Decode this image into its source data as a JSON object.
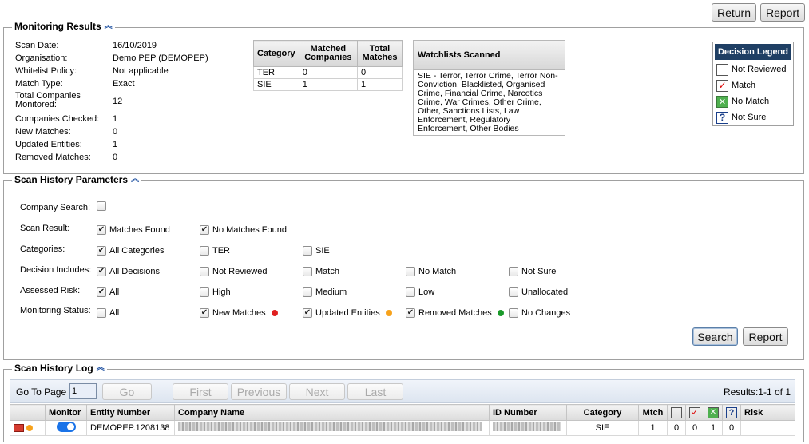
{
  "top_buttons": {
    "return_label": "Return",
    "report_label": "Report"
  },
  "monitoring": {
    "title": "Monitoring Results",
    "fields": [
      {
        "label": "Scan Date:",
        "value": "16/10/2019"
      },
      {
        "label": "Organisation:",
        "value": "Demo PEP (DEMOPEP)"
      },
      {
        "label": "Whitelist Policy:",
        "value": "Not applicable"
      },
      {
        "label": "Match Type:",
        "value": "Exact"
      },
      {
        "label": "Total Companies Monitored:",
        "value": "12"
      },
      {
        "label": "Companies Checked:",
        "value": "1"
      },
      {
        "label": "New Matches:",
        "value": "0"
      },
      {
        "label": "Updated Entities:",
        "value": "1"
      },
      {
        "label": "Removed Matches:",
        "value": "0"
      }
    ],
    "category_table": {
      "headers": [
        "Category",
        "Matched Companies",
        "Total Matches"
      ],
      "rows": [
        [
          "TER",
          "0",
          "0"
        ],
        [
          "SIE",
          "1",
          "1"
        ]
      ]
    },
    "watchlists": {
      "header": "Watchlists Scanned",
      "text": "SIE - Terror, Terror Crime, Terror Non-Conviction, Blacklisted, Organised Crime, Financial Crime, Narcotics Crime, War Crimes, Other Crime, Other, Sanctions Lists, Law Enforcement, Regulatory Enforcement, Other Bodies"
    },
    "decision_legend": {
      "title": "Decision Legend",
      "items": [
        "Not Reviewed",
        "Match",
        "No Match",
        "Not Sure"
      ]
    }
  },
  "params": {
    "title": "Scan History Parameters",
    "company_search_label": "Company Search:",
    "scan_result_label": "Scan Result:",
    "scan_result": [
      "Matches Found",
      "No Matches Found"
    ],
    "categories_label": "Categories:",
    "categories": [
      "All Categories",
      "TER",
      "SIE"
    ],
    "decision_label": "Decision Includes:",
    "decisions": [
      "All Decisions",
      "Not Reviewed",
      "Match",
      "No Match",
      "Not Sure"
    ],
    "risk_label": "Assessed Risk:",
    "risks": [
      "All",
      "High",
      "Medium",
      "Low",
      "Unallocated"
    ],
    "status_label": "Monitoring Status:",
    "statuses": [
      "All",
      "New Matches",
      "Updated Entities",
      "Removed Matches",
      "No Changes"
    ],
    "search_label": "Search",
    "report_label": "Report",
    "dot_colors": {
      "new": "#e02020",
      "updated": "#f7a21b",
      "removed": "#1a9a2a"
    }
  },
  "log": {
    "title": "Scan History Log",
    "goto_label": "Go To Page",
    "page_value": "1",
    "go_label": "Go",
    "first_label": "First",
    "previous_label": "Previous",
    "next_label": "Next",
    "last_label": "Last",
    "results_text": "Results:1-1 of 1",
    "headers": [
      "Monitor",
      "Entity Number",
      "Company Name",
      "ID Number",
      "Category",
      "Mtch",
      "Risk"
    ],
    "row": {
      "entity_number": "DEMOPEP.1208138",
      "category": "SIE",
      "mtch": "1",
      "counts": [
        "0",
        "0",
        "1",
        "0"
      ]
    }
  }
}
